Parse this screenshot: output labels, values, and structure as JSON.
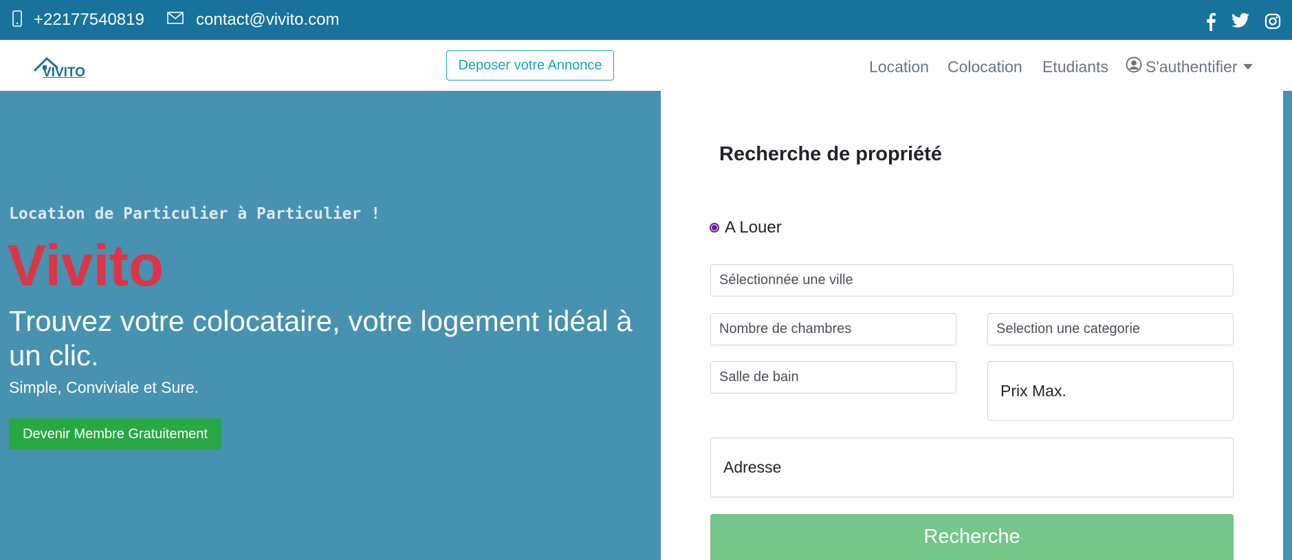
{
  "topbar": {
    "phone_icon": "phone-icon",
    "phone": "+22177540819",
    "email_icon": "mail-icon",
    "email": "contact@vivito.com",
    "socials": [
      "facebook-icon",
      "twitter-icon",
      "instagram-icon"
    ]
  },
  "navbar": {
    "logo_text": "VIVITO",
    "deposit_label": "Deposer votre Annonce",
    "links": [
      "Location",
      "Colocation",
      "Etudiants"
    ],
    "auth_label": "S'authentifier"
  },
  "hero": {
    "tagline": "Location de Particulier à Particulier !",
    "brand": "Vivito",
    "headline": "Trouvez votre colocataire, votre logement idéal à un clic.",
    "subline": "Simple, Conviviale et Sure.",
    "join_label": "Devenir Membre Gratuitement"
  },
  "search": {
    "title": "Recherche de propriété",
    "radio_label": "A Louer",
    "ville_placeholder": "Sélectionnée une ville",
    "chambres_placeholder": "Nombre de chambres",
    "categorie_placeholder": "Selection une categorie",
    "salle_placeholder": "Salle de bain",
    "prix_placeholder": "Prix Max.",
    "adresse_placeholder": "Adresse",
    "button_label": "Recherche"
  },
  "colors": {
    "topbar": "#17729c",
    "hero": "#4791b1",
    "brand_red": "#dc3545",
    "join_green": "#28a745",
    "search_green": "#76c689",
    "deposit_teal": "#17a2b8"
  }
}
